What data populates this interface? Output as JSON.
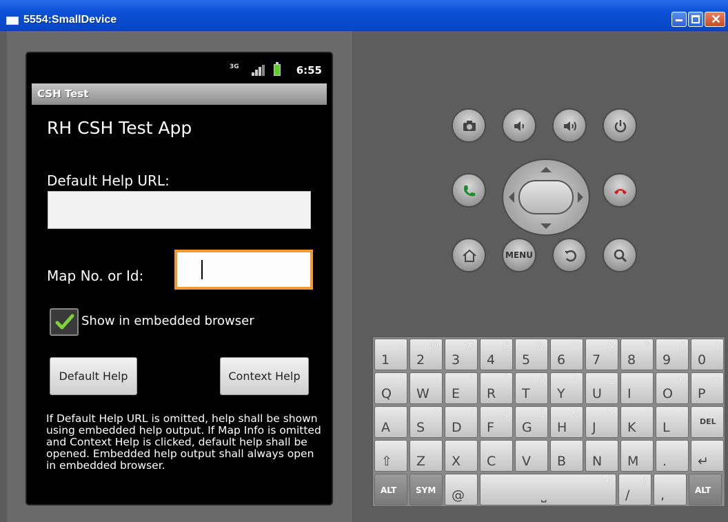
{
  "window": {
    "title": "5554:SmallDevice"
  },
  "status_bar": {
    "network": "3G",
    "time": "6:55"
  },
  "app": {
    "titlebar": "CSH Test",
    "heading": "RH CSH Test App",
    "default_help_url_label": "Default Help URL:",
    "default_help_url_value": "",
    "map_label": "Map No. or Id:",
    "map_value": "",
    "checkbox_label": "Show in embedded browser",
    "checkbox_checked": true,
    "default_help_button": "Default Help",
    "context_help_button": "Context Help",
    "footnote": "If Default Help URL is omitted, help shall be shown using embedded help output. If Map Info is omitted and Context Help is clicked, default help shall be opened. Embedded help output shall always open in embedded browser."
  },
  "controls": {
    "menu_label": "MENU",
    "buttons": [
      "camera-icon",
      "volume-down-icon",
      "volume-up-icon",
      "power-icon",
      "call-icon",
      "end-call-icon",
      "home-icon",
      "menu",
      "back-icon",
      "search-icon"
    ]
  },
  "keyboard": {
    "row1": [
      {
        "main": "1",
        "alt": "!"
      },
      {
        "main": "2",
        "alt": "@"
      },
      {
        "main": "3",
        "alt": "#"
      },
      {
        "main": "4",
        "alt": "$"
      },
      {
        "main": "5",
        "alt": "%"
      },
      {
        "main": "6",
        "alt": "^"
      },
      {
        "main": "7",
        "alt": "&"
      },
      {
        "main": "8",
        "alt": "*"
      },
      {
        "main": "9",
        "alt": "("
      },
      {
        "main": "0",
        "alt": ")"
      }
    ],
    "row2": [
      {
        "main": "Q",
        "alt": "|"
      },
      {
        "main": "W",
        "alt": "~"
      },
      {
        "main": "E",
        "alt": "\""
      },
      {
        "main": "R",
        "alt": "`"
      },
      {
        "main": "T",
        "alt": "{"
      },
      {
        "main": "Y",
        "alt": "}"
      },
      {
        "main": "U",
        "alt": "_"
      },
      {
        "main": "I",
        "alt": "-"
      },
      {
        "main": "O",
        "alt": "+"
      },
      {
        "main": "P",
        "alt": "="
      }
    ],
    "row3": [
      {
        "main": "A",
        "alt": ""
      },
      {
        "main": "S",
        "alt": "\\"
      },
      {
        "main": "D",
        "alt": "'"
      },
      {
        "main": "F",
        "alt": "["
      },
      {
        "main": "G",
        "alt": "]"
      },
      {
        "main": "H",
        "alt": "<"
      },
      {
        "main": "J",
        "alt": ">"
      },
      {
        "main": "K",
        "alt": ";"
      },
      {
        "main": "L",
        "alt": ":"
      },
      {
        "main": "DEL",
        "alt": ""
      }
    ],
    "row4": [
      {
        "main": "⇧",
        "alt": ""
      },
      {
        "main": "Z",
        "alt": ""
      },
      {
        "main": "X",
        "alt": ""
      },
      {
        "main": "C",
        "alt": ""
      },
      {
        "main": "V",
        "alt": ""
      },
      {
        "main": "B",
        "alt": ""
      },
      {
        "main": "N",
        "alt": ""
      },
      {
        "main": "M",
        "alt": ""
      },
      {
        "main": ".",
        "alt": ""
      },
      {
        "main": "↵",
        "alt": ""
      }
    ],
    "row5": [
      {
        "main": "ALT",
        "alt": ""
      },
      {
        "main": "SYM",
        "alt": ""
      },
      {
        "main": "@",
        "alt": ""
      },
      {
        "main": "⎵",
        "alt": "→|"
      },
      {
        "main": "/",
        "alt": "?"
      },
      {
        "main": ",",
        "alt": ""
      },
      {
        "main": "ALT",
        "alt": ""
      }
    ]
  }
}
